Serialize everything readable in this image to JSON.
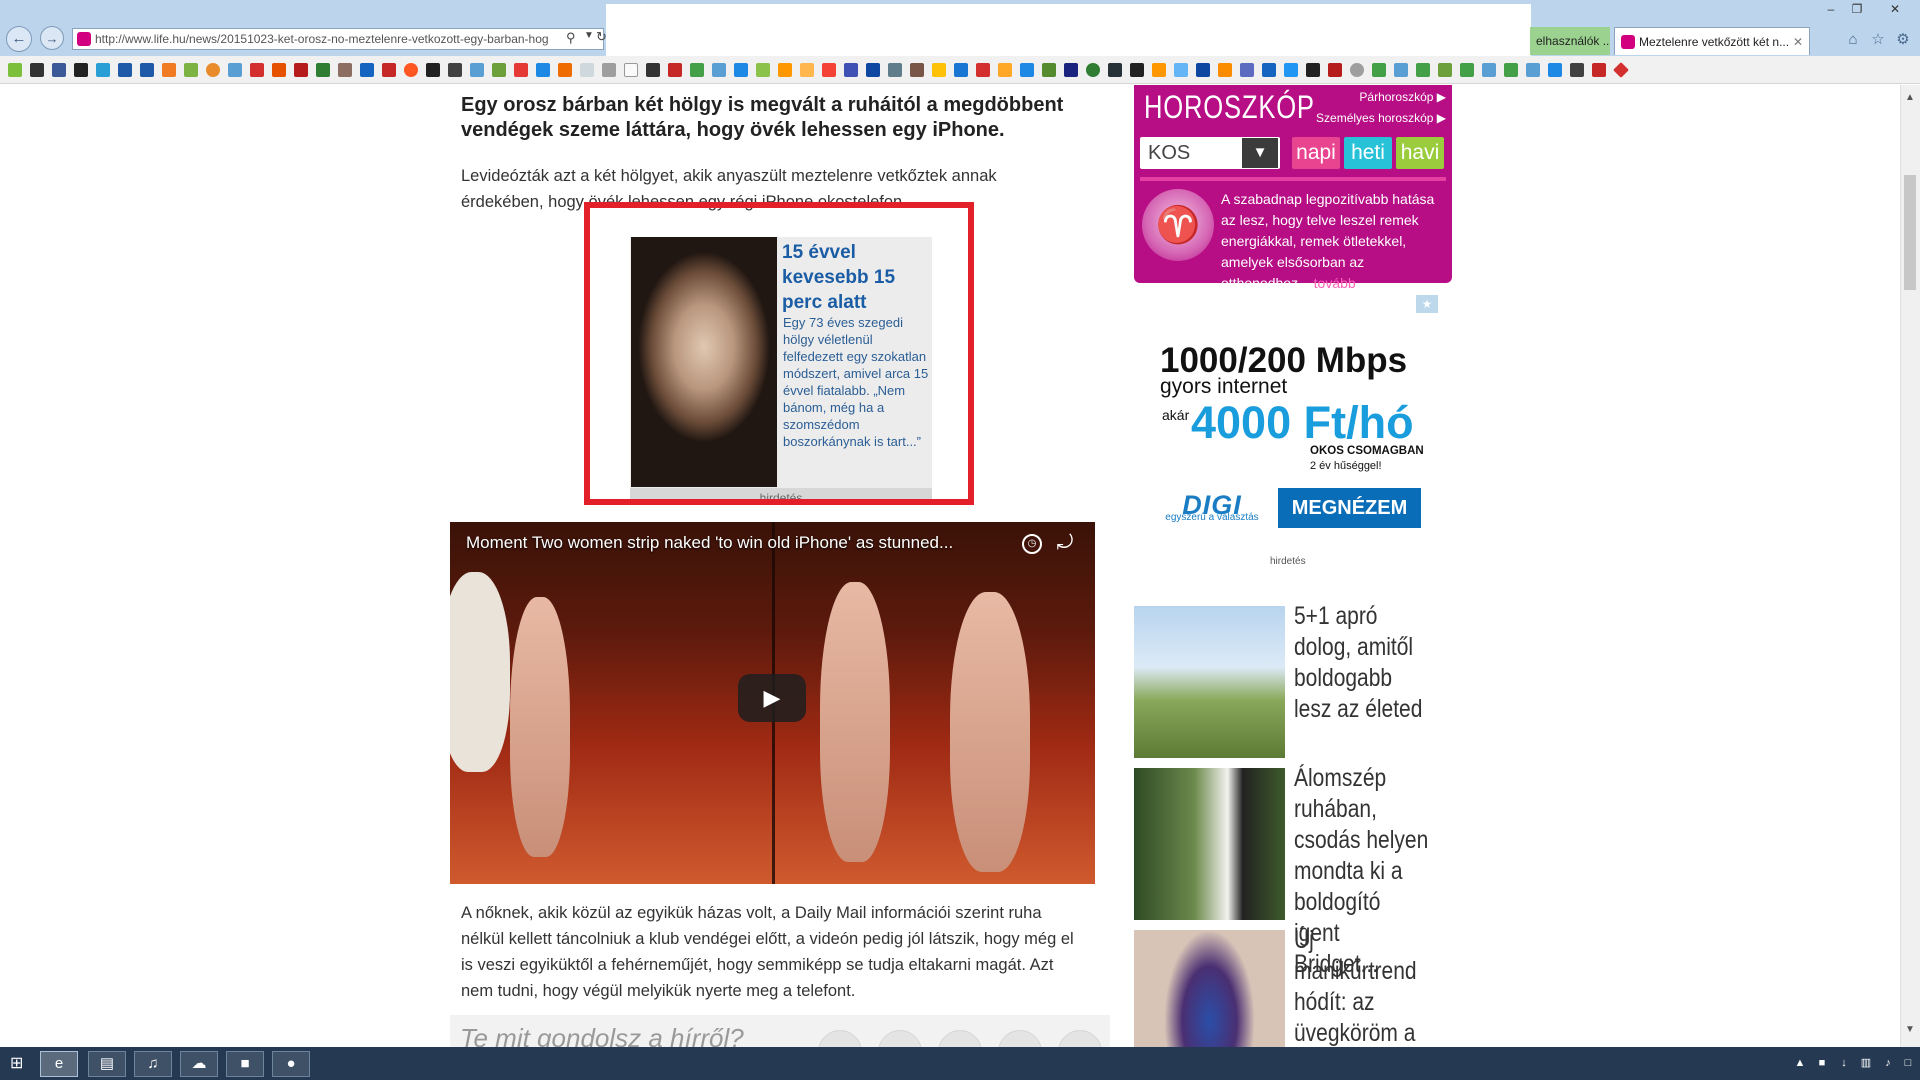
{
  "browser": {
    "url": "http://www.life.hu/news/20151023-ket-orosz-no-meztelenre-vetkozott-egy-barban-hog",
    "tabs": [
      {
        "label": "elhasználók ..."
      },
      {
        "label": "Meztelenre vetkőzött két n..."
      }
    ],
    "accent_color": "#d2007f"
  },
  "article": {
    "lead": "Egy orosz bárban két hölgy is megvált a ruháitól a megdöbbent vendégek szeme láttára, hogy övék lehessen egy iPhone.",
    "intro": "Levideózták azt a két hölgyet, akik anyaszült meztelenre vetkőztek annak érdekében, hogy övék lehessen egy régi iPhone okostelefon.",
    "ad": {
      "headline": "15 évvel kevesebb 15 perc alatt",
      "text": "Egy 73 éves szegedi hölgy véletlenül felfedezett egy szokatlan módszert, amivel arca 15 évvel fiatalabb. „Nem bánom, még ha a szomszédom boszorkánynak is tart...”",
      "label": "hirdetés",
      "highlight_color": "#e3202a"
    },
    "video": {
      "title": "Moment Two women strip naked 'to win old iPhone' as stunned..."
    },
    "body": "A nőknek, akik közül az egyikük házas volt, a Daily Mail információi szerint ruha nélkül kellett táncolniuk a klub vendégei előtt, a videón pedig jól látszik, hogy még el is veszi egyiküktől a fehérneműjét, hogy semmiképp se tudja eltakarni magát. Azt nem tudni, hogy végül melyikük nyerte meg a telefont.",
    "comment_prompt": "Te mit gondolsz a hírről?"
  },
  "horoscope": {
    "title": "HOROSZKÓP",
    "link_pair": "Párhoroszkóp",
    "link_personal": "Személyes horoszkóp",
    "sign": "KOS",
    "tabs": [
      {
        "label": "napi",
        "color": "#e9448f"
      },
      {
        "label": "heti",
        "color": "#27c2d8"
      },
      {
        "label": "havi",
        "color": "#9bcc3e"
      }
    ],
    "text": "A szabadnap legpozitívabb hatása az lesz, hogy telve leszel remek energiákkal, remek ötletekkel, amelyek elsősorban az otthonodhoz...",
    "more": "tovább",
    "bg_color": "#b70e85"
  },
  "digi_ad": {
    "speed": "1000/200 Mbps",
    "sub": "gyors internet",
    "from": "akár",
    "price": "4000 Ft/hó",
    "package": "OKOS CSOMAGBAN",
    "loyalty": "2 év hűséggel!",
    "logo": "DIGI",
    "slogan": "egyszerű a választás",
    "button": "MEGNÉZEM",
    "label": "hirdetés"
  },
  "articles": [
    {
      "title": "5+1 apró dolog, amitől boldogabb lesz az életed"
    },
    {
      "title": "Álomszép ruhában, csodás helyen mondta ki a boldogító igent Bridget..."
    },
    {
      "title": "Új manikűrtrend hódít: az üvegköröm a legmenőbb"
    }
  ]
}
